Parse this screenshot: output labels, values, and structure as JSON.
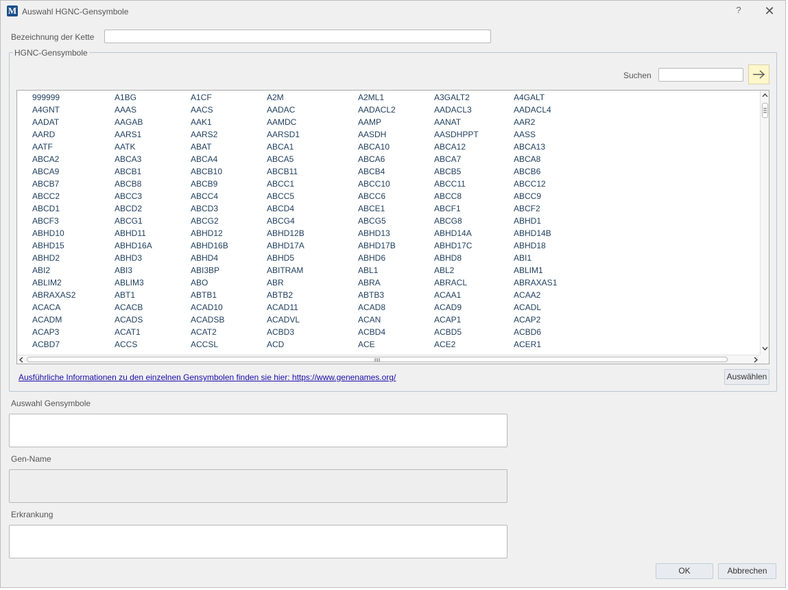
{
  "window": {
    "title": "Auswahl HGNC-Gensymbole",
    "help_label": "?",
    "close_label": "✕"
  },
  "chain": {
    "label": "Bezeichnung der Kette",
    "value": ""
  },
  "group": {
    "title": "HGNC-Gensymbole",
    "search_label": "Suchen",
    "search_value": ""
  },
  "gene_rows": [
    [
      "999999",
      "A1BG",
      "A1CF",
      "A2M",
      "A2ML1",
      "A3GALT2",
      "A4GALT"
    ],
    [
      "A4GNT",
      "AAAS",
      "AACS",
      "AADAC",
      "AADACL2",
      "AADACL3",
      "AADACL4"
    ],
    [
      "AADAT",
      "AAGAB",
      "AAK1",
      "AAMDC",
      "AAMP",
      "AANAT",
      "AAR2"
    ],
    [
      "AARD",
      "AARS1",
      "AARS2",
      "AARSD1",
      "AASDH",
      "AASDHPPT",
      "AASS"
    ],
    [
      "AATF",
      "AATK",
      "ABAT",
      "ABCA1",
      "ABCA10",
      "ABCA12",
      "ABCA13"
    ],
    [
      "ABCA2",
      "ABCA3",
      "ABCA4",
      "ABCA5",
      "ABCA6",
      "ABCA7",
      "ABCA8"
    ],
    [
      "ABCA9",
      "ABCB1",
      "ABCB10",
      "ABCB11",
      "ABCB4",
      "ABCB5",
      "ABCB6"
    ],
    [
      "ABCB7",
      "ABCB8",
      "ABCB9",
      "ABCC1",
      "ABCC10",
      "ABCC11",
      "ABCC12"
    ],
    [
      "ABCC2",
      "ABCC3",
      "ABCC4",
      "ABCC5",
      "ABCC6",
      "ABCC8",
      "ABCC9"
    ],
    [
      "ABCD1",
      "ABCD2",
      "ABCD3",
      "ABCD4",
      "ABCE1",
      "ABCF1",
      "ABCF2"
    ],
    [
      "ABCF3",
      "ABCG1",
      "ABCG2",
      "ABCG4",
      "ABCG5",
      "ABCG8",
      "ABHD1"
    ],
    [
      "ABHD10",
      "ABHD11",
      "ABHD12",
      "ABHD12B",
      "ABHD13",
      "ABHD14A",
      "ABHD14B"
    ],
    [
      "ABHD15",
      "ABHD16A",
      "ABHD16B",
      "ABHD17A",
      "ABHD17B",
      "ABHD17C",
      "ABHD18"
    ],
    [
      "ABHD2",
      "ABHD3",
      "ABHD4",
      "ABHD5",
      "ABHD6",
      "ABHD8",
      "ABI1"
    ],
    [
      "ABI2",
      "ABI3",
      "ABI3BP",
      "ABITRAM",
      "ABL1",
      "ABL2",
      "ABLIM1"
    ],
    [
      "ABLIM2",
      "ABLIM3",
      "ABO",
      "ABR",
      "ABRA",
      "ABRACL",
      "ABRAXAS1"
    ],
    [
      "ABRAXAS2",
      "ABT1",
      "ABTB1",
      "ABTB2",
      "ABTB3",
      "ACAA1",
      "ACAA2"
    ],
    [
      "ACACA",
      "ACACB",
      "ACAD10",
      "ACAD11",
      "ACAD8",
      "ACAD9",
      "ACADL"
    ],
    [
      "ACADM",
      "ACADS",
      "ACADSB",
      "ACADVL",
      "ACAN",
      "ACAP1",
      "ACAP2"
    ],
    [
      "ACAP3",
      "ACAT1",
      "ACAT2",
      "ACBD3",
      "ACBD4",
      "ACBD5",
      "ACBD6"
    ],
    [
      "ACBD7",
      "ACCS",
      "ACCSL",
      "ACD",
      "ACE",
      "ACE2",
      "ACER1"
    ]
  ],
  "info_link": "Ausführliche Informationen zu den einzelnen Gensymbolen finden sie hier: https://www.genenames.org/",
  "select_button": "Auswählen",
  "selection": {
    "label": "Auswahl Gensymbole",
    "value": ""
  },
  "gene_name": {
    "label": "Gen-Name",
    "value": ""
  },
  "disease": {
    "label": "Erkrankung",
    "value": ""
  },
  "ok_button": "OK",
  "cancel_button": "Abbrechen",
  "colors": {
    "link": "#1a0dab",
    "arrow_button_bg": "#fdf7c9",
    "list_text": "#1d3d5c"
  },
  "icons": {
    "app": "app-logo-icon",
    "search_go": "arrow-right-icon"
  }
}
